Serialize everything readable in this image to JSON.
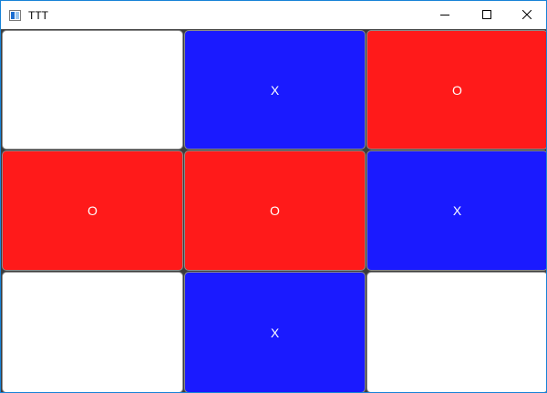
{
  "window": {
    "title": "TTT",
    "controls": {
      "minimize_icon": "minimize-icon",
      "maximize_icon": "maximize-icon",
      "close_icon": "close-icon"
    }
  },
  "colors": {
    "x": "#1a1aff",
    "o": "#ff1a1a",
    "empty": "#ffffff",
    "board_bg": "#3c3c3c"
  },
  "board": {
    "cells": [
      {
        "mark": ""
      },
      {
        "mark": "X"
      },
      {
        "mark": "O"
      },
      {
        "mark": "O"
      },
      {
        "mark": "O"
      },
      {
        "mark": "X"
      },
      {
        "mark": ""
      },
      {
        "mark": "X"
      },
      {
        "mark": ""
      }
    ]
  }
}
